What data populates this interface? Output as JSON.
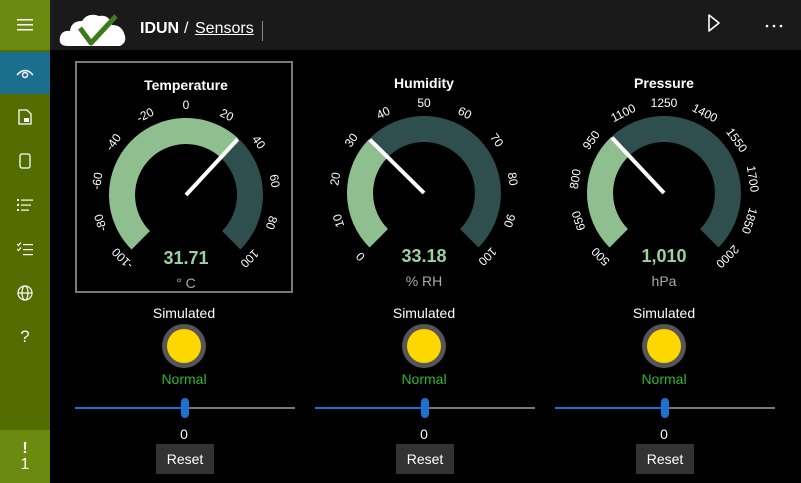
{
  "app": {
    "title": "IDUN",
    "separator": "/",
    "breadcrumb": "Sensors"
  },
  "sidebar": {
    "items": [
      {
        "icon": "hamburger-icon"
      },
      {
        "icon": "eye-icon",
        "active": true
      },
      {
        "icon": "document-lock-icon"
      },
      {
        "icon": "page-icon"
      },
      {
        "icon": "list-icon"
      },
      {
        "icon": "checklist-icon"
      },
      {
        "icon": "globe-icon"
      },
      {
        "icon": "help-icon",
        "glyph": "?"
      }
    ],
    "alert": {
      "symbol": "!",
      "count": "1"
    }
  },
  "colors": {
    "sidebar": "#536d00",
    "accent_active": "#1a6f8f",
    "gauge_fill": "#8fbf8f",
    "gauge_rest": "#2f4f4f",
    "led": "#ffd700",
    "status_ok": "#2eb82e",
    "slider": "#1a73d0"
  },
  "gauges": [
    {
      "title": "Temperature",
      "min": -100,
      "max": 100,
      "ticks": [
        "-100",
        "-80",
        "-60",
        "-40",
        "-20",
        "0",
        "20",
        "40",
        "60",
        "80",
        "100"
      ],
      "value": 31.71,
      "value_text": "31.71",
      "unit": "° C",
      "needle_value": 31.71,
      "selected": true,
      "simulated_label": "Simulated",
      "status": "Normal",
      "slider_value": "0",
      "slider_fraction": 0.5,
      "reset_label": "Reset"
    },
    {
      "title": "Humidity",
      "min": 0,
      "max": 100,
      "ticks": [
        "0",
        "10",
        "20",
        "30",
        "40",
        "50",
        "60",
        "70",
        "80",
        "90",
        "100"
      ],
      "value": 33.18,
      "value_text": "33.18",
      "unit": "% RH",
      "needle_value": 33.18,
      "selected": false,
      "simulated_label": "Simulated",
      "status": "Normal",
      "slider_value": "0",
      "slider_fraction": 0.5,
      "reset_label": "Reset"
    },
    {
      "title": "Pressure",
      "min": 500,
      "max": 2000,
      "ticks": [
        "500",
        "650",
        "800",
        "950",
        "1100",
        "1250",
        "1400",
        "1550",
        "1700",
        "1850",
        "2000"
      ],
      "value": 1010,
      "value_text": "1,010",
      "unit": "hPa",
      "needle_value": 1010,
      "selected": false,
      "simulated_label": "Simulated",
      "status": "Normal",
      "slider_value": "0",
      "slider_fraction": 0.5,
      "reset_label": "Reset"
    }
  ]
}
